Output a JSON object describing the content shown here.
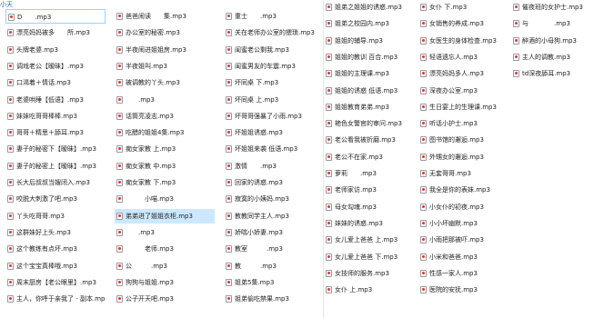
{
  "breadcrumb": "小天",
  "left_pane": {
    "columns": [
      {
        "items": [
          {
            "name": "D　　.mp3",
            "state": "focus"
          },
          {
            "name": "漂亮妈妈被多　　所.mp3"
          },
          {
            "name": "头牌老婆.mp3"
          },
          {
            "name": "调戏老公【暧昧】.mp3"
          },
          {
            "name": "口渴着＋情话.mp3"
          },
          {
            "name": "老婆哄睡【低语】.mp3"
          },
          {
            "name": "妹妹吃哥哥棒棒.mp3"
          },
          {
            "name": "哥哥＋精思＋舔耳.mp3"
          },
          {
            "name": "妻子的秘密下【暧昧】.mp3"
          },
          {
            "name": "妻子的秘密上【暧昧】.mp3"
          },
          {
            "name": "长大后叔叔当嫂闭入.mp3"
          },
          {
            "name": "咬脱大刺激了吧.mp3"
          },
          {
            "name": "丫头吃哥哥.mp3"
          },
          {
            "name": "这群妹好上头.mp3"
          },
          {
            "name": "这个教练有点坏.mp3"
          },
          {
            "name": "这个宝宝真棒哦.mp3"
          },
          {
            "name": "周末厨房【老公眼里】.mp3"
          },
          {
            "name": "主人，你呼于亲我了 - 副本.mp3"
          }
        ]
      },
      {
        "items": [
          {
            "name": "爸爸闹读　　集.mp3"
          },
          {
            "name": "办公室的秘密.mp3"
          },
          {
            "name": "半夜闹进姐姐房.mp3"
          },
          {
            "name": "半夜姐叫.mp3"
          },
          {
            "name": "被调教的丫头.mp3"
          },
          {
            "name": "　　.mp3"
          },
          {
            "name": "话筒亮凌志.mp3"
          },
          {
            "name": "吃醋的姐姐4集.mp3"
          },
          {
            "name": "痴女家教 上.mp3"
          },
          {
            "name": "痴女家教 中.mp3"
          },
          {
            "name": "痴女家教 下.mp3"
          },
          {
            "name": "　　　小喵.mp3"
          },
          {
            "name": "弟弟进了姐姐衣柜.mp3",
            "state": "sel"
          },
          {
            "name": "　　.mp3"
          },
          {
            "name": "　　　老师.mp3"
          },
          {
            "name": "公　　　.mp3"
          },
          {
            "name": "狗狗与姐姐.mp3"
          },
          {
            "name": "公子开天吧.mp3"
          }
        ]
      },
      {
        "items": [
          {
            "name": "重士　　.mp3"
          },
          {
            "name": "关在老师办公室的猥琐.mp3"
          },
          {
            "name": "闺蜜老公剩我.mp3"
          },
          {
            "name": "闺蜜男友的车震.mp3"
          },
          {
            "name": "坏同桌 下.mp3"
          },
          {
            "name": "坏同桌 上.mp3"
          },
          {
            "name": "坏哥哥强暴了小雨.mp3"
          },
          {
            "name": "坏姐姐诱惑.mp3"
          },
          {
            "name": "坏姐姐来袭 低语.mp3"
          },
          {
            "name": "激情　　.mp3"
          },
          {
            "name": "回家的诱惑.mp3"
          },
          {
            "name": "寂寞的小姨妈.mp3"
          },
          {
            "name": "教教同学主人.mp3"
          },
          {
            "name": "娇喘小娇妻.mp3"
          },
          {
            "name": "教室　　　.mp3"
          },
          {
            "name": "教　　　.mp3"
          },
          {
            "name": "姐弟5集.mp3"
          },
          {
            "name": "姐弟偷吃禁果.mp3"
          }
        ]
      }
    ]
  },
  "right_pane": {
    "columns": [
      {
        "items": [
          {
            "name": "姐弟之姐姐的诱惑.mp3"
          },
          {
            "name": "姐弟之校园内.mp3"
          },
          {
            "name": "姐姐的辅导.mp3"
          },
          {
            "name": "姐姐的教训 百合.mp3"
          },
          {
            "name": "姐姐的主理课.mp3"
          },
          {
            "name": "姐姐的诱惑 低语.mp3"
          },
          {
            "name": "姐姐教育弟弟.mp3"
          },
          {
            "name": "艳色女警官的审问.mp3"
          },
          {
            "name": "老公看我被折磨.mp3"
          },
          {
            "name": "老公不在家.mp3"
          },
          {
            "name": "萝莉　　.mp3"
          },
          {
            "name": "老师家访.mp3"
          },
          {
            "name": "母女勾魂.mp3"
          },
          {
            "name": "妹妹的诱惑.mp3"
          },
          {
            "name": "女儿爱上爸爸 上.mp3"
          },
          {
            "name": "女儿爱上爸爸 下.mp3"
          },
          {
            "name": "女技师的服务.mp3"
          },
          {
            "name": "女仆 上.mp3"
          }
        ]
      },
      {
        "items": [
          {
            "name": "女仆 下.mp3"
          },
          {
            "name": "女销售的养成.mp3"
          },
          {
            "name": "女医生的身体检查.mp3"
          },
          {
            "name": "轻语遗忘人.mp3"
          },
          {
            "name": "漂亮妈妈多人.mp3"
          },
          {
            "name": "深夜办公室.mp3"
          },
          {
            "name": "生日宴上的生理课.mp3"
          },
          {
            "name": "听话小护士.mp3"
          },
          {
            "name": "图书馆的邂逅.mp3"
          },
          {
            "name": "外甥女的邂逅.mp3"
          },
          {
            "name": "无套哥哥.mp3"
          },
          {
            "name": "我全是你的表妹.mp3"
          },
          {
            "name": "小女仆的初夜.mp3"
          },
          {
            "name": "小小坏幽默.mp3"
          },
          {
            "name": "小雨把那被吓.mp3"
          },
          {
            "name": "小米和爸爸.mp3"
          },
          {
            "name": "性感一家人.mp3"
          },
          {
            "name": "医院的安抚.mp3"
          }
        ]
      },
      {
        "items": [
          {
            "name": "催夜班的女护士.mp3"
          },
          {
            "name": "与　　　　.mp3"
          },
          {
            "name": "醉酒的小母狗.mp3"
          },
          {
            "name": "主人的调教.mp3"
          },
          {
            "name": "td深夜舔耳.mp3"
          }
        ]
      }
    ]
  },
  "colors": {
    "selected_bg": "#cce8ff",
    "focus_border": "#99d1ff",
    "breadcrumb": "#1a66c8",
    "icon_accent": "#d9383a"
  }
}
